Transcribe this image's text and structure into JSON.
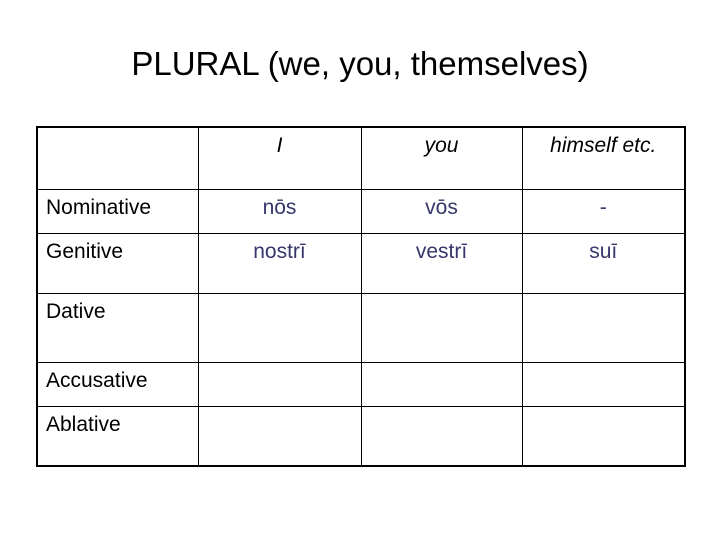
{
  "slide": {
    "title": "PLURAL (we, you, themselves)",
    "background_color": "#ffffff",
    "text_color": "#000000",
    "latin_color": "#36366b"
  },
  "table": {
    "column_headers": {
      "case_column": "",
      "first_person": "I",
      "second_person": "you",
      "third_person_italic": "himself",
      "third_person_plain": " etc."
    },
    "rows": [
      {
        "case": "Nominative",
        "first_person": "nōs",
        "second_person": "vōs",
        "third_person": "-"
      },
      {
        "case": "Genitive",
        "first_person": "nostrī",
        "second_person": "vestrī",
        "third_person": "suī"
      },
      {
        "case": "Dative",
        "first_person": "",
        "second_person": "",
        "third_person": ""
      },
      {
        "case": "Accusative",
        "first_person": "",
        "second_person": "",
        "third_person": ""
      },
      {
        "case": "Ablative",
        "first_person": "",
        "second_person": "",
        "third_person": ""
      }
    ]
  }
}
